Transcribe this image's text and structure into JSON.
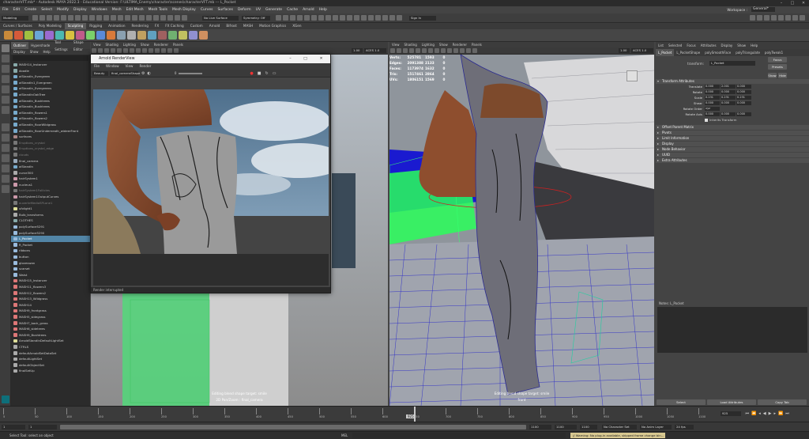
{
  "app": {
    "window_title": "characterVFT.mb* - Autodesk MAYA 2022.3 - Educational Version: F:\\ULTIMA_Enemy\\character\\scenes\\characterVFT.mb --- L_Pocket"
  },
  "menubar": [
    "File",
    "Edit",
    "Create",
    "Select",
    "Modify",
    "Display",
    "Windows",
    "Mesh",
    "Edit Mesh",
    "Mesh Tools",
    "Mesh Display",
    "Curves",
    "Surfaces",
    "Deform",
    "UV",
    "Generate",
    "Cache",
    "Arnold",
    "Help"
  ],
  "workspace": {
    "label": "Workspace :",
    "value": "General*"
  },
  "statusline": {
    "mode": "Modeling",
    "live_surface": "No Live Surface",
    "symmetry": "Symmetry: Off",
    "signin": "Sign In"
  },
  "shelf_tabs": [
    "Curves / Surfaces",
    "Poly Modeling",
    "Sculpting",
    "Rigging",
    "Animation",
    "Rendering",
    "FX",
    "FX Caching",
    "Custom",
    "Arnold",
    "Bifrost",
    "MASH",
    "Motion Graphics",
    "XGen"
  ],
  "shelf_active": "Sculpting",
  "shelf_colors": [
    "#c98a3a",
    "#d65a3a",
    "#a0c040",
    "#6aa6d8",
    "#9b6ad0",
    "#4cb8b0",
    "#d8c040",
    "#c05a8a",
    "#7ad06a",
    "#5a8ad8",
    "#d87a3a",
    "#8aa0b0",
    "#b0b0b0",
    "#c0a060",
    "#60a0c0",
    "#a06060",
    "#70b070",
    "#c0c060",
    "#9090d0",
    "#d09060"
  ],
  "outliner": {
    "tabs": [
      "Outliner",
      "Hypershade",
      "Tool Settings",
      "Shape Editor"
    ],
    "menu": [
      "Display",
      "Show",
      "Help"
    ],
    "items": [
      {
        "label": "MASH14_Instancer",
        "state": "normal",
        "icon": "#8aa"
      },
      {
        "label": "doodle",
        "state": "normal",
        "icon": "#8aa"
      },
      {
        "label": "aiStandIn_Evergreen",
        "state": "normal",
        "icon": "#7ac"
      },
      {
        "label": "aiStandIn1_Evergreen",
        "state": "normal",
        "icon": "#7ac"
      },
      {
        "label": "aiStandIn_Evergreens",
        "state": "normal",
        "icon": "#7ac"
      },
      {
        "label": "aiStandInOakTree",
        "state": "normal",
        "icon": "#7ac"
      },
      {
        "label": "aiStandIn_Bushtrees",
        "state": "normal",
        "icon": "#7ac"
      },
      {
        "label": "aiStandIn_Bushtrees",
        "state": "normal",
        "icon": "#7ac"
      },
      {
        "label": "aiStandIn_flowers1",
        "state": "normal",
        "icon": "#7ac"
      },
      {
        "label": "aiStandIn_flowers2",
        "state": "normal",
        "icon": "#7ac"
      },
      {
        "label": "aiStandIn_floorWildgrass",
        "state": "normal",
        "icon": "#7ac"
      },
      {
        "label": "aiStandIn_floorUnderneath_wideerFront",
        "state": "normal",
        "icon": "#7ac"
      },
      {
        "label": "surfaces",
        "state": "normal",
        "icon": "#a88"
      },
      {
        "label": "Eruptions_crystal",
        "state": "dim",
        "icon": "#777"
      },
      {
        "label": "Eruptions_crystal_edge",
        "state": "dim",
        "icon": "#777"
      },
      {
        "label": "clouds",
        "state": "dim",
        "icon": "#777"
      },
      {
        "label": "final_camera",
        "state": "normal",
        "icon": "#9ab"
      },
      {
        "label": "aiStandIn",
        "state": "normal",
        "icon": "#7ac"
      },
      {
        "label": "curve300",
        "state": "normal",
        "icon": "#aaa"
      },
      {
        "label": "hairSystem1",
        "state": "normal",
        "icon": "#c9a"
      },
      {
        "label": "nucleus1",
        "state": "normal",
        "icon": "#c9a"
      },
      {
        "label": "hairSystem1Follicles",
        "state": "dim",
        "icon": "#777"
      },
      {
        "label": "hairSystem1OutputCurves",
        "state": "normal",
        "icon": "#c9a"
      },
      {
        "label": "ouverteMedioSPLane1",
        "state": "dim",
        "icon": "#777"
      },
      {
        "label": "ufvlight1",
        "state": "normal",
        "icon": "#dd9"
      },
      {
        "label": "Bulb_transforms",
        "state": "normal",
        "icon": "#aaa"
      },
      {
        "label": "CLOTHES",
        "state": "normal",
        "icon": "#8aa"
      },
      {
        "label": "polySurface5291",
        "state": "normal",
        "icon": "#9bd"
      },
      {
        "label": "polySurface5290",
        "state": "normal",
        "icon": "#9bd"
      },
      {
        "label": "L_Pocket",
        "state": "selected",
        "icon": "#9bd"
      },
      {
        "label": "R_Pocket",
        "state": "normal",
        "icon": "#9bd"
      },
      {
        "label": "ribbons",
        "state": "normal",
        "icon": "#9bd"
      },
      {
        "label": "button",
        "state": "normal",
        "icon": "#9bd"
      },
      {
        "label": "gloveswan",
        "state": "normal",
        "icon": "#9bd"
      },
      {
        "label": "scarset",
        "state": "normal",
        "icon": "#9bd"
      },
      {
        "label": "Waist",
        "state": "normal",
        "icon": "#9bd"
      },
      {
        "label": "MASH15_Instancer",
        "state": "normal",
        "icon": "#d77"
      },
      {
        "label": "MASH11_flowers3",
        "state": "normal",
        "icon": "#d77"
      },
      {
        "label": "MASH12_flowers2",
        "state": "normal",
        "icon": "#d77"
      },
      {
        "label": "MASH13_Wildgrass",
        "state": "normal",
        "icon": "#d77"
      },
      {
        "label": "MASH14",
        "state": "normal",
        "icon": "#d77"
      },
      {
        "label": "MASH9_frontgrass",
        "state": "normal",
        "icon": "#d77"
      },
      {
        "label": "MASH5_sidegrass",
        "state": "normal",
        "icon": "#d77"
      },
      {
        "label": "MASH7_back_grass",
        "state": "normal",
        "icon": "#d77"
      },
      {
        "label": "MASH6_sidetrees",
        "state": "normal",
        "icon": "#d77"
      },
      {
        "label": "MASH9_Bushtrees",
        "state": "normal",
        "icon": "#d77"
      },
      {
        "label": "ArnoldStandInDefaultLightSet",
        "state": "normal",
        "icon": "#dd9"
      },
      {
        "label": "CTRLS",
        "state": "normal",
        "icon": "#aaa"
      },
      {
        "label": "defaultArnoldSetDataSet",
        "state": "normal",
        "icon": "#aaa"
      },
      {
        "label": "defaultLightSet",
        "state": "normal",
        "icon": "#aaa"
      },
      {
        "label": "defaultObjectSet",
        "state": "normal",
        "icon": "#aaa"
      },
      {
        "label": "finalSetUp",
        "state": "normal",
        "icon": "#aaa"
      }
    ]
  },
  "viewport_left": {
    "menu": [
      "View",
      "Shading",
      "Lighting",
      "Show",
      "Renderer",
      "Panels"
    ],
    "zoom": "1.00",
    "colorspace": "ACES 1.0 SDR-video",
    "caption1": "Editing blend shape target: smile",
    "caption2": "2D Pan/Zoom : final_camera"
  },
  "viewport_right": {
    "menu": [
      "View",
      "Shading",
      "Lighting",
      "Show",
      "Renderer",
      "Panels"
    ],
    "zoom": "1.00",
    "colorspace": "ACES 1.0 SDR-video",
    "hud": [
      {
        "label": "Verts:",
        "a": "525781",
        "b": "1593",
        "c": "0"
      },
      {
        "label": "Edges:",
        "a": "2091388",
        "b": "2133",
        "c": "0"
      },
      {
        "label": "Faces:",
        "a": "1173974",
        "b": "1632",
        "c": "0"
      },
      {
        "label": "Tris:",
        "a": "1517461",
        "b": "2864",
        "c": "0"
      },
      {
        "label": "UVs:",
        "a": "1806151",
        "b": "1569",
        "c": "0"
      }
    ],
    "caption1": "Editing blend shape target: smile",
    "caption2": "front"
  },
  "render_view": {
    "title": "Arnold RenderView",
    "menu": [
      "File",
      "Window",
      "View",
      "Render"
    ],
    "aov": "Beauty",
    "camera": "final_cameraShape",
    "exposure": "0",
    "status": "Render interrupted"
  },
  "attribute_editor": {
    "tabs": [
      "List",
      "Selected",
      "Focus",
      "Attributes",
      "Display",
      "Show",
      "Help"
    ],
    "node_tabs": [
      "L_Pocket",
      "L_PocketShape",
      "polySmoothFace",
      "polyTriangulate",
      "polyTweak1"
    ],
    "transform_label": "transform:",
    "transform_value": "L_Pocket",
    "focus_btn": "Focus",
    "presets_btn": "Presets",
    "show_btn": "Show",
    "hide_btn": "Hide",
    "section_transform": "Transform Attributes",
    "rows": [
      {
        "label": "Translate",
        "v": [
          "0.000",
          "2.001",
          "0.000"
        ]
      },
      {
        "label": "Rotate",
        "v": [
          "0.000",
          "0.000",
          "0.000"
        ]
      },
      {
        "label": "Scale",
        "v": [
          "0.231",
          "0.231",
          "0.231"
        ]
      },
      {
        "label": "Shear",
        "v": [
          "0.000",
          "0.000",
          "0.000"
        ]
      }
    ],
    "rotate_order_label": "Rotate Order",
    "rotate_order": "xyz",
    "rotate_axis_label": "Rotate Axis",
    "rotate_axis": [
      "0.000",
      "0.000",
      "0.000"
    ],
    "inherits": "Inherits Transform",
    "sections": [
      "Offset Parent Matrix",
      "Pivots",
      "Limit Information",
      "Display",
      "Node Behavior",
      "UUID",
      "Extra Attributes"
    ],
    "notes_label": "Notes: L_Pocket",
    "select_btn": "Select",
    "load_btn": "Load Attributes",
    "copy_btn": "Copy Tab"
  },
  "timeslider": {
    "ticks": [
      "5",
      "50",
      "100",
      "150",
      "200",
      "250",
      "300",
      "350",
      "400",
      "450",
      "500",
      "550",
      "600",
      "650",
      "700",
      "750",
      "800",
      "850",
      "900",
      "950",
      "1000",
      "1050",
      "1100"
    ],
    "current": "925",
    "current_field": "925"
  },
  "rangeslider": {
    "start": "1",
    "start2": "1",
    "end": "1100",
    "end2": "1100",
    "end3": "1100",
    "character_set": "No Character Set",
    "anim_layer": "No Anim Layer",
    "fps": "24 fps"
  },
  "cmdline": {
    "lang": "MEL",
    "help": "Select Tool: select an object",
    "warning": "// Warning: No plug-in available, skipped frame change bin...",
    "input": ""
  }
}
